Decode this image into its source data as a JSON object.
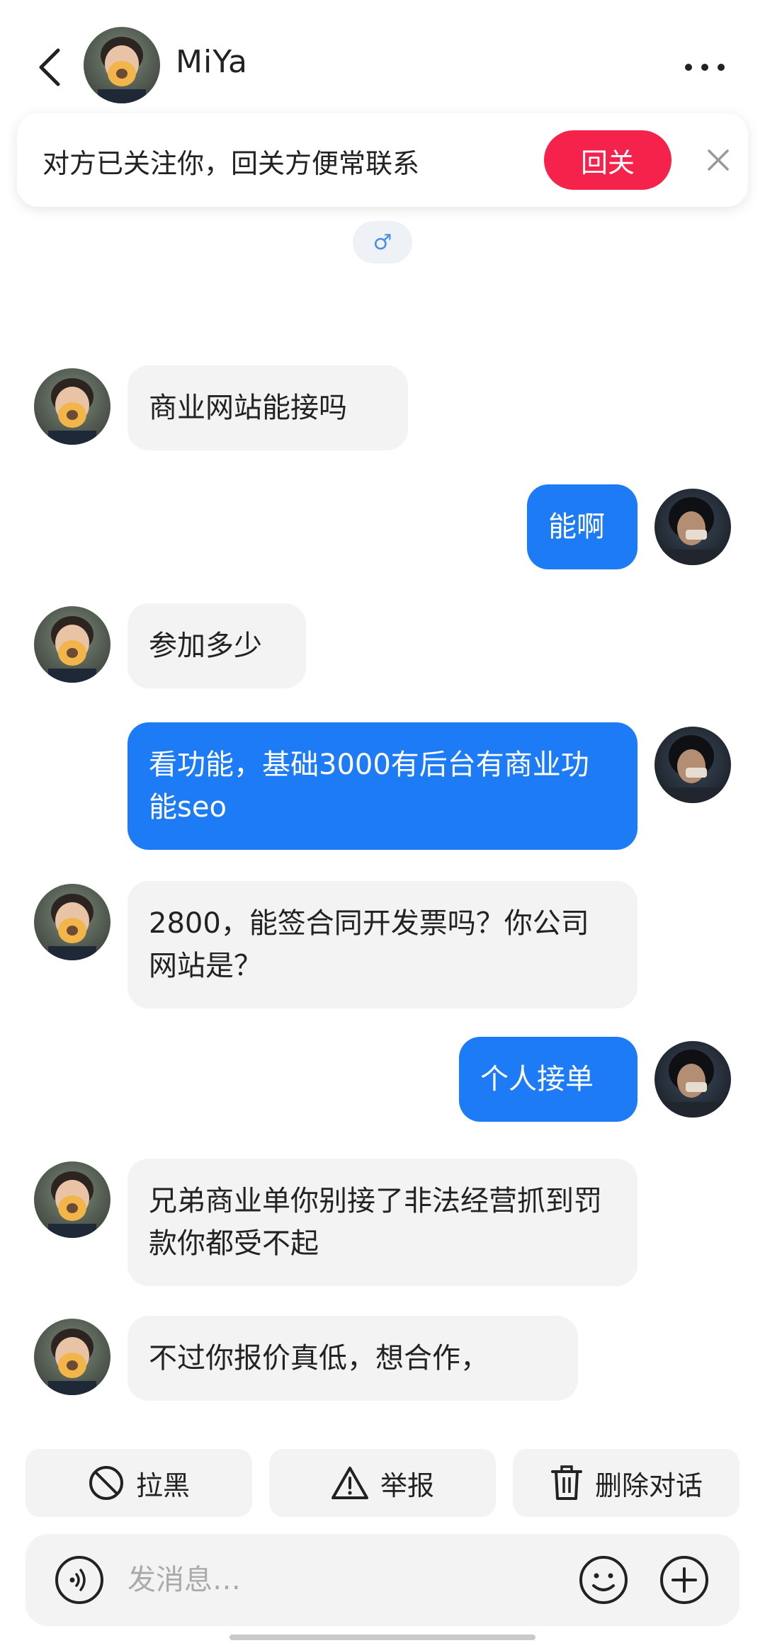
{
  "header": {
    "contact_name": "MiYa"
  },
  "banner": {
    "text": "对方已关注你，回关方便常联系",
    "follow_label": "回关"
  },
  "gender_symbol": "♂",
  "messages": [
    {
      "side": "in",
      "text": "商业网站能接吗"
    },
    {
      "side": "out",
      "text": "能啊"
    },
    {
      "side": "in",
      "text": "参加多少"
    },
    {
      "side": "out",
      "text": "看功能，基础3000有后台有商业功能seo"
    },
    {
      "side": "in",
      "text": "2800，能签合同开发票吗？你公司网站是？"
    },
    {
      "side": "out",
      "text": "个人接单"
    },
    {
      "side": "in",
      "text": "兄弟商业单你别接了非法经营抓到罚款你都受不起"
    },
    {
      "side": "in",
      "text": "不过你报价真低，想合作，"
    }
  ],
  "actions": {
    "block": {
      "label": "拉黑",
      "icon": "block-icon"
    },
    "report": {
      "label": "举报",
      "icon": "warning-icon"
    },
    "delete": {
      "label": "删除对话",
      "icon": "trash-icon"
    }
  },
  "composer": {
    "placeholder": "发消息…"
  },
  "colors": {
    "follow_button": "#f5234b",
    "outgoing_bubble": "#1d7bf5",
    "incoming_bubble": "#f3f3f3"
  }
}
